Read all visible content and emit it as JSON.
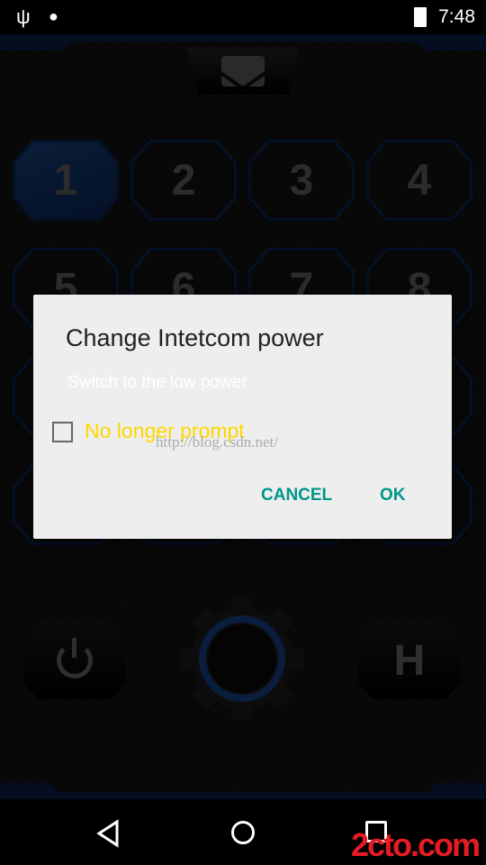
{
  "status_bar": {
    "time": "7:48",
    "icons": [
      "usb-icon",
      "android-debug-icon",
      "battery-charging-icon"
    ]
  },
  "app": {
    "mail_icon": "envelope-icon",
    "channels": [
      {
        "label": "1",
        "selected": true
      },
      {
        "label": "2"
      },
      {
        "label": "3"
      },
      {
        "label": "4"
      },
      {
        "label": "5"
      },
      {
        "label": "6"
      },
      {
        "label": "7"
      },
      {
        "label": "8"
      },
      {
        "label": ""
      },
      {
        "label": ""
      },
      {
        "label": ""
      },
      {
        "label": ""
      },
      {
        "label": ""
      },
      {
        "label": ""
      },
      {
        "label": ""
      },
      {
        "label": ""
      }
    ],
    "power_icon": "power-icon",
    "settings_icon": "gear-icon",
    "h_label": "H",
    "accent": "#0b2350"
  },
  "dialog": {
    "title": "Change Intetcom power",
    "message": "Switch to the low power",
    "checkbox_label": "No longer prompt",
    "checkbox_checked": false,
    "cancel": "CANCEL",
    "ok": "OK",
    "button_color": "#009688"
  },
  "watermark": {
    "url": "http://blog.csdn.net/",
    "logo": "2cto.com"
  },
  "nav": {
    "back": "back-icon",
    "home": "home-icon",
    "recents": "recents-icon"
  }
}
